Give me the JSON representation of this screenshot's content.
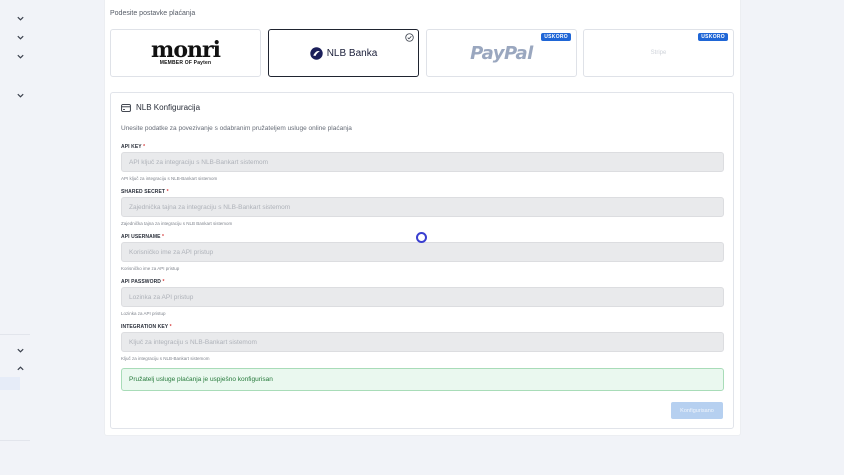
{
  "section_label": "Podesite postavke plaćanja",
  "providers": {
    "monri": {
      "logo_word": "monri",
      "logo_sub": "MEMBER OF Payten"
    },
    "nlb": {
      "logo_text": "NLB Banka"
    },
    "paypal": {
      "logo_text": "PayPal",
      "badge": "USKORO"
    },
    "stripe": {
      "logo_text": "Stripe",
      "badge": "USKORO"
    }
  },
  "config": {
    "title": "NLB Konfiguracija",
    "description": "Unesite podatke za povezivanje s odabranim pružateljem usluge online plaćanja",
    "fields": [
      {
        "label": "API KEY",
        "required": "*",
        "placeholder": "API ključ za integraciju s NLB-Bankart sistemom",
        "help": "API ključ za integraciju s NLB-Bankart sistemom"
      },
      {
        "label": "SHARED SECRET",
        "required": "*",
        "placeholder": "Zajednička tajna za integraciju s NLB-Bankart sistemom",
        "help": "Zajednička tajna za integraciju s NLB Bankart sistemom"
      },
      {
        "label": "API USERNAME",
        "required": "*",
        "placeholder": "Korisničko ime za API pristup",
        "help": "Korisničko ime za API pristup"
      },
      {
        "label": "API PASSWORD",
        "required": "*",
        "placeholder": "Lozinka za API pristup",
        "help": "Lozinka za API pristup"
      },
      {
        "label": "INTEGRATION KEY",
        "required": "*",
        "placeholder": "Ključ za integraciju s NLB-Bankart sistemom",
        "help": "Ključ za integraciju s NLB-Bankart sistemom"
      }
    ],
    "success_message": "Pružatelj usluge plaćanja je uspješno konfigurisan",
    "submit_label": "Konfigurisano"
  },
  "icons": {
    "sidebar": "chevron-down-icon",
    "sidebar_open": "chevron-up-icon",
    "config": "credit-card-icon",
    "selected": "check-circle-icon"
  },
  "colors": {
    "accent": "#1f66d6",
    "success_text": "#267a3b",
    "required": "#d63c3c"
  }
}
